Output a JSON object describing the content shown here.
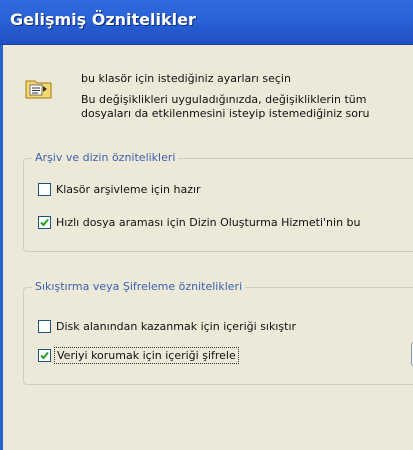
{
  "window": {
    "title": "Gelişmiş Öznitelikler"
  },
  "intro": {
    "icon": "folder-settings-icon",
    "line1": "bu klasör için istediğiniz ayarları seçin",
    "line2": "Bu değişiklikleri uyguladığınızda, değişikliklerin tüm",
    "line3": "dosyaları da etkilenmesini isteyip istemediğiniz soru"
  },
  "archive_group": {
    "legend": "Arşiv ve dizin öznitelikleri",
    "items": [
      {
        "label": "Klasör arşivleme için hazır",
        "checked": false
      },
      {
        "label": "Hızlı dosya araması için Dizin Oluşturma Hizmeti'nin bu",
        "checked": true
      }
    ]
  },
  "compress_group": {
    "legend": "Sıkıştırma veya Şifreleme öznitelikleri",
    "items": [
      {
        "label": "Disk alanından kazanmak için içeriği sıkıştır",
        "checked": false
      },
      {
        "label": "Veriyi korumak için içeriği şifrele",
        "checked": true
      }
    ]
  },
  "colors": {
    "titlebar": "#2a63d6",
    "legend": "#3b5fb3",
    "check": "#21a121"
  }
}
